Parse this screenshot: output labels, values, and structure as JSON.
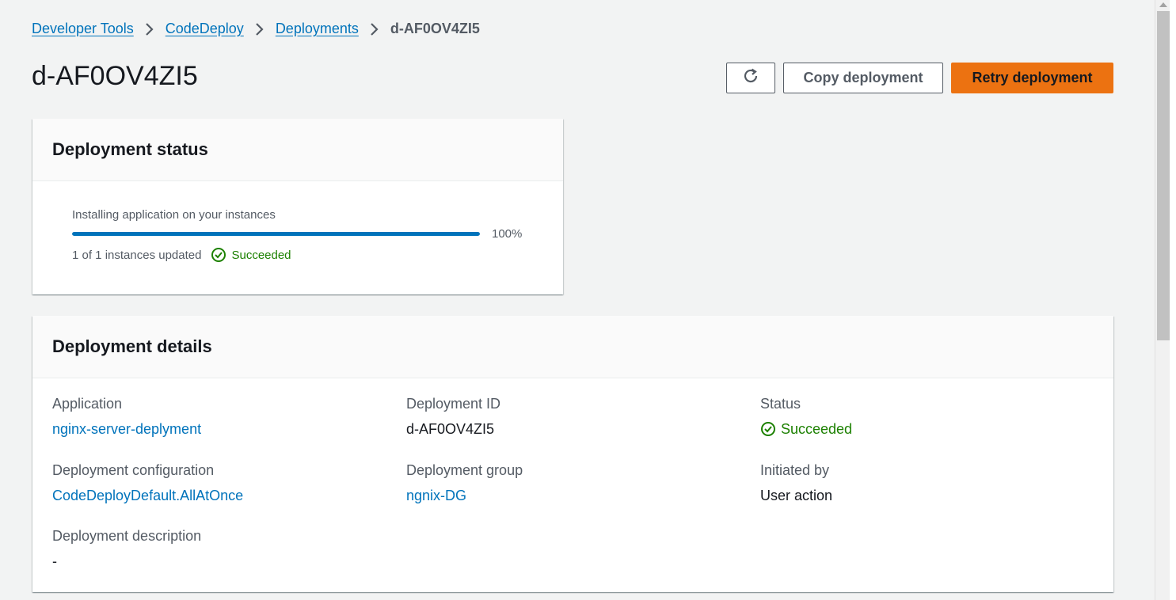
{
  "breadcrumb": {
    "items": [
      "Developer Tools",
      "CodeDeploy",
      "Deployments"
    ],
    "current": "d-AF0OV4ZI5"
  },
  "header": {
    "title": "d-AF0OV4ZI5",
    "refresh_icon": "refresh-icon",
    "copy_label": "Copy deployment",
    "retry_label": "Retry deployment"
  },
  "status_card": {
    "title": "Deployment status",
    "progress_label": "Installing application on your instances",
    "progress_fraction": 1.0,
    "progress_text": "100%",
    "instances_text": "1 of 1 instances updated",
    "status": "Succeeded"
  },
  "details": {
    "title": "Deployment details",
    "application_label": "Application",
    "application_value": "nginx-server-deplyment",
    "deployment_id_label": "Deployment ID",
    "deployment_id_value": "d-AF0OV4ZI5",
    "status_label": "Status",
    "status_value": "Succeeded",
    "config_label": "Deployment configuration",
    "config_value": "CodeDeployDefault.AllAtOnce",
    "group_label": "Deployment group",
    "group_value": "ngnix-DG",
    "initiated_label": "Initiated by",
    "initiated_value": "User action",
    "description_label": "Deployment description",
    "description_value": "-"
  },
  "colors": {
    "link": "#0073bb",
    "success": "#1d8102",
    "primary_button": "#ec7211",
    "progress": "#0073bb"
  }
}
